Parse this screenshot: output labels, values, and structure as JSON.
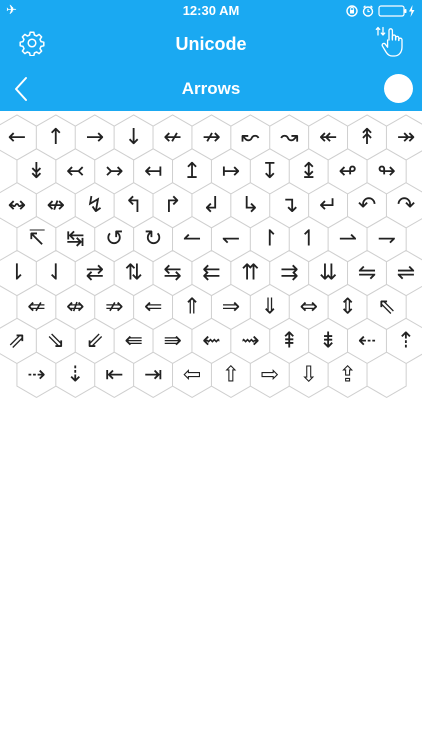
{
  "status_bar": {
    "time": "12:30 AM",
    "airplane_glyph": "✈",
    "icons": [
      "airplane-icon",
      "orientation-lock-icon",
      "alarm-icon",
      "battery-icon",
      "charging-bolt-icon"
    ]
  },
  "nav": {
    "title": "Unicode",
    "subtitle": "Arrows",
    "icons": {
      "settings": "gear-icon",
      "touch": "touch-hand-icon",
      "back": "chevron-left-icon",
      "toggle": "toggle-knob"
    }
  },
  "colors": {
    "header": "#1aa9f2",
    "hex_border": "#cfcfcf",
    "glyph": "#222222"
  },
  "symbols": [
    "←",
    "↑",
    "→",
    "↓",
    "↚",
    "↛",
    "↜",
    "↝",
    "↞",
    "↟",
    "↠",
    "↡",
    "↢",
    "↣",
    "↤",
    "↥",
    "↦",
    "↧",
    "↨",
    "↫",
    "↬",
    "↭",
    "↮",
    "↯",
    "↰",
    "↱",
    "↲",
    "↳",
    "↴",
    "↵",
    "↶",
    "↷",
    "↸",
    "↹",
    "↺",
    "↻",
    "↼",
    "↽",
    "↾",
    "↿",
    "⇀",
    "⇁",
    "⇂",
    "⇃",
    "⇄",
    "⇅",
    "⇆",
    "⇇",
    "⇈",
    "⇉",
    "⇊",
    "⇋",
    "⇌",
    "⇍",
    "⇎",
    "⇏",
    "⇐",
    "⇑",
    "⇒",
    "⇓",
    "⇔",
    "⇕",
    "⇖",
    "⇗",
    "⇘",
    "⇙",
    "⇚",
    "⇛",
    "⇜",
    "⇝",
    "⇞",
    "⇟",
    "⇠",
    "⇡",
    "⇢",
    "⇣",
    "⇤",
    "⇥",
    "⇦",
    "⇧",
    "⇨",
    "⇩",
    "⇪",
    ""
  ]
}
